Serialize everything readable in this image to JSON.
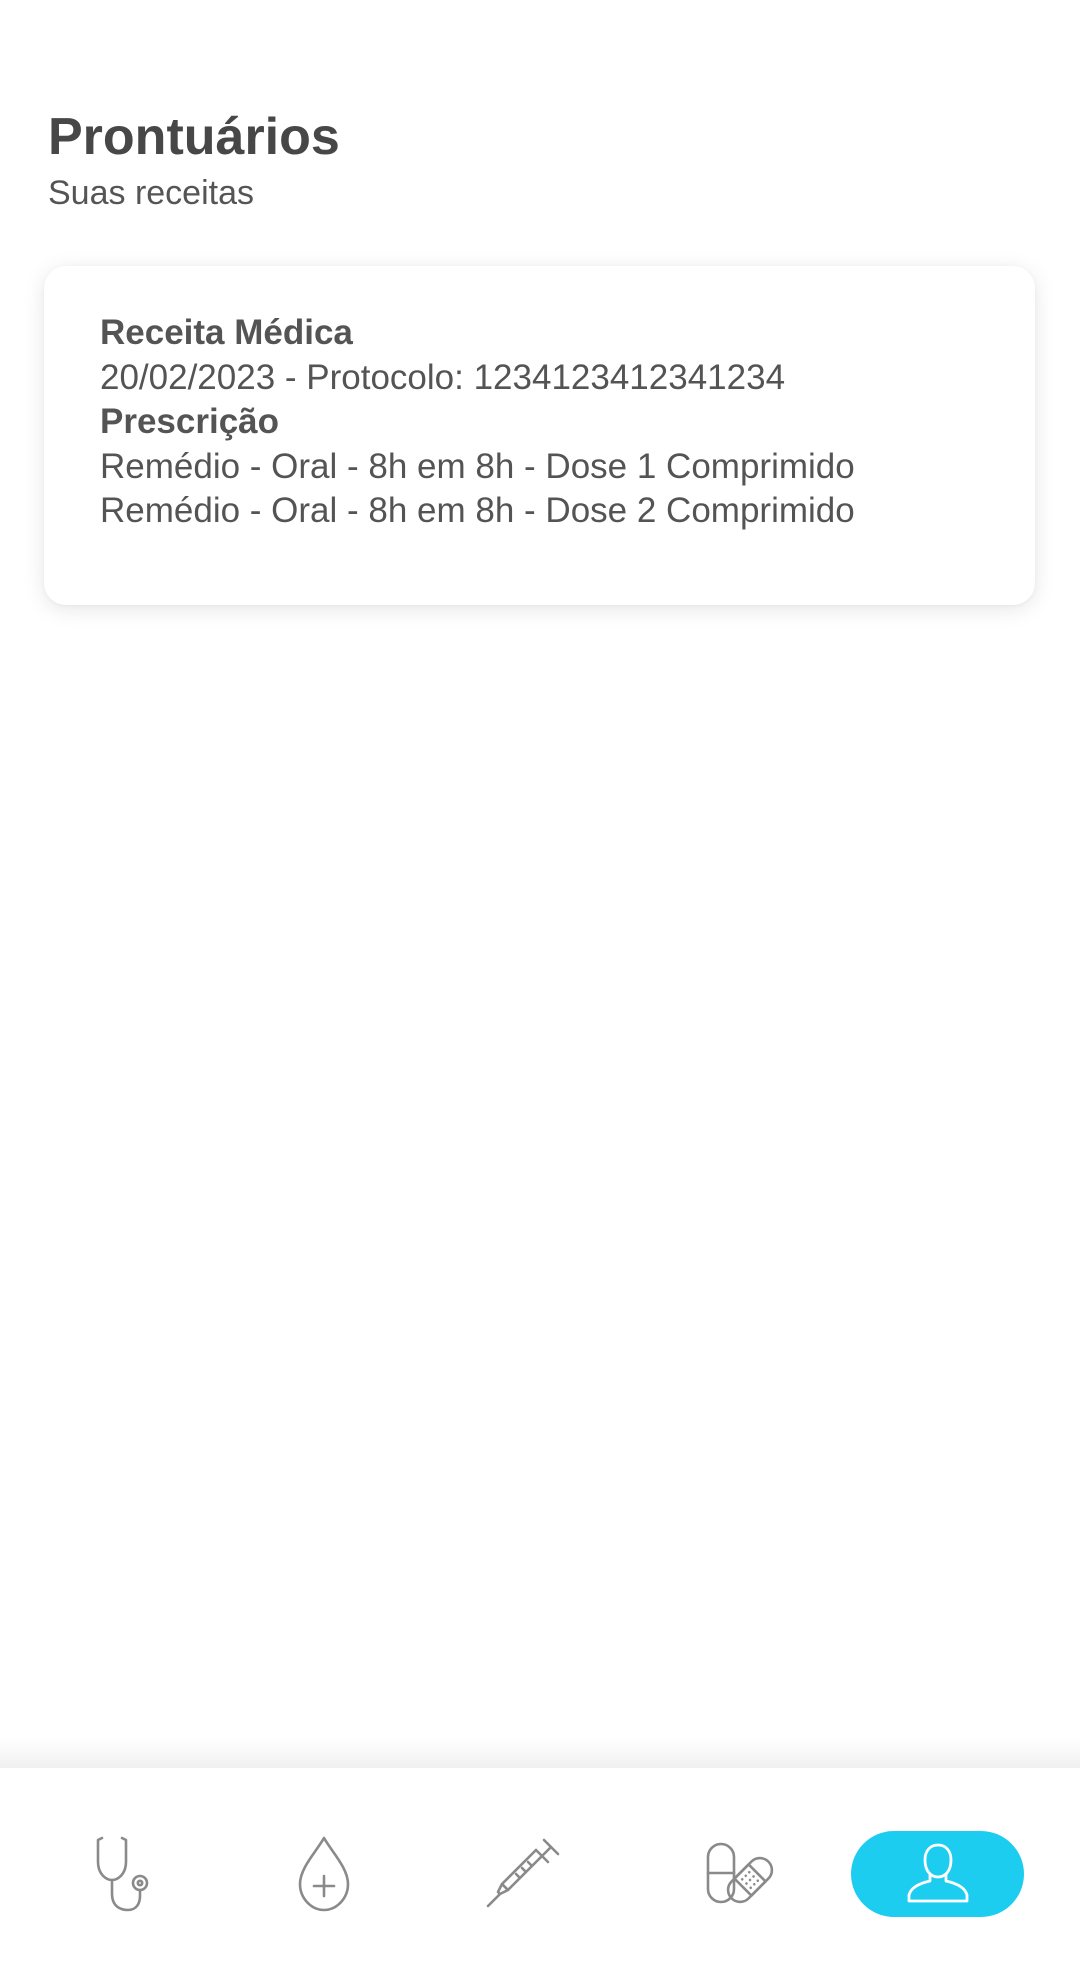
{
  "header": {
    "title": "Prontuários",
    "subtitle": "Suas receitas"
  },
  "prescription_card": {
    "title": "Receita Médica",
    "date_protocol": "20/02/2023 - Protocolo: 1234123412341234",
    "section_label": "Prescrição",
    "items": [
      "Remédio - Oral - 8h em 8h - Dose 1 Comprimido",
      "Remédio - Oral - 8h em 8h - Dose 2 Comprimido"
    ]
  },
  "bottom_nav": {
    "items": [
      {
        "icon": "stethoscope-icon",
        "active": false
      },
      {
        "icon": "blood-drop-plus-icon",
        "active": false
      },
      {
        "icon": "syringe-icon",
        "active": false
      },
      {
        "icon": "pill-bandage-icon",
        "active": false
      },
      {
        "icon": "user-icon",
        "active": true
      }
    ],
    "active_color": "#1ccdf0",
    "icon_color": "#8a8a8a"
  }
}
